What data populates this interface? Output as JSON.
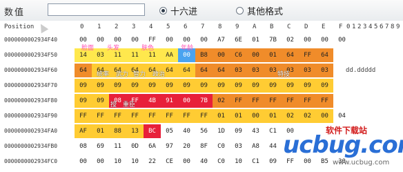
{
  "toolbar": {
    "value_label": "数值",
    "value_input": "",
    "radio_hex": "十六进",
    "radio_other": "其他格式",
    "hex_selected": true
  },
  "header": {
    "position_label": "Position",
    "hex_cols": [
      "0",
      "1",
      "2",
      "3",
      "4",
      "5",
      "6",
      "7",
      "8",
      "9",
      "A",
      "B",
      "C",
      "D",
      "E",
      "F"
    ],
    "ascii_cols": [
      "0",
      "1",
      "2",
      "3",
      "4",
      "5",
      "6",
      "7",
      "8",
      "9"
    ]
  },
  "rows": [
    {
      "addr": "0000000002934F40",
      "bytes": [
        "00",
        "00",
        "00",
        "00",
        "FF",
        "00",
        "00",
        "00",
        "A7",
        "6E",
        "01",
        "7B",
        "02",
        "00",
        "00",
        "00"
      ],
      "ascii": ""
    },
    {
      "addr": "0000000002934F50",
      "bytes": [
        "14",
        "03",
        "11",
        "11",
        "11",
        "AA",
        "00",
        "B8",
        "00",
        "C6",
        "00",
        "01",
        "64",
        "FF",
        "64",
        ""
      ],
      "ascii": ""
    },
    {
      "addr": "0000000002934F60",
      "bytes": [
        "64",
        "64",
        "64",
        "64",
        "64",
        "64",
        "64",
        "64",
        "64",
        "03",
        "03",
        "03",
        "03",
        "03",
        "03",
        ""
      ],
      "ascii": "dd.ddddd"
    },
    {
      "addr": "0000000002934F70",
      "bytes": [
        "09",
        "09",
        "09",
        "09",
        "09",
        "09",
        "09",
        "09",
        "09",
        "09",
        "09",
        "09",
        "09",
        "09",
        "09",
        ""
      ],
      "ascii": ""
    },
    {
      "addr": "0000000002934F80",
      "bytes": [
        "09",
        "09",
        "08",
        "FF",
        "4B",
        "91",
        "00",
        "7B",
        "02",
        "FF",
        "FF",
        "FF",
        "FF",
        "FF",
        "FF",
        ""
      ],
      "ascii": ""
    },
    {
      "addr": "0000000002934F90",
      "bytes": [
        "FF",
        "FF",
        "FF",
        "FF",
        "FF",
        "FF",
        "FF",
        "FF",
        "01",
        "01",
        "00",
        "01",
        "02",
        "02",
        "00",
        "04"
      ],
      "ascii": ""
    },
    {
      "addr": "0000000002934FA0",
      "bytes": [
        "AF",
        "01",
        "88",
        "13",
        "BC",
        "05",
        "40",
        "56",
        "1D",
        "09",
        "43",
        "C1",
        "00",
        "",
        "",
        ""
      ],
      "ascii": ""
    },
    {
      "addr": "0000000002934FB0",
      "bytes": [
        "08",
        "69",
        "11",
        "0D",
        "6A",
        "97",
        "20",
        "8F",
        "C0",
        "03",
        "A8",
        "44",
        "",
        "",
        "",
        ""
      ],
      "ascii": ""
    },
    {
      "addr": "0000000002934FC0",
      "bytes": [
        "00",
        "00",
        "10",
        "10",
        "22",
        "CE",
        "00",
        "40",
        "C0",
        "10",
        "C1",
        "09",
        "FF",
        "00",
        "B5",
        "30"
      ],
      "ascii": ""
    }
  ],
  "annotations": {
    "face": "脸面",
    "hair": "头发",
    "skin": "肤色",
    "age": "年龄",
    "command": "统率",
    "force": "武力",
    "wisdom": "智力",
    "politics": "政治",
    "skill": "特技",
    "grant": "授",
    "minister": "重臣"
  },
  "watermark": {
    "site_top": "软件下载站",
    "logo": "ucbug",
    "logo_accent": ".com",
    "url": "www.ucbug.com"
  }
}
